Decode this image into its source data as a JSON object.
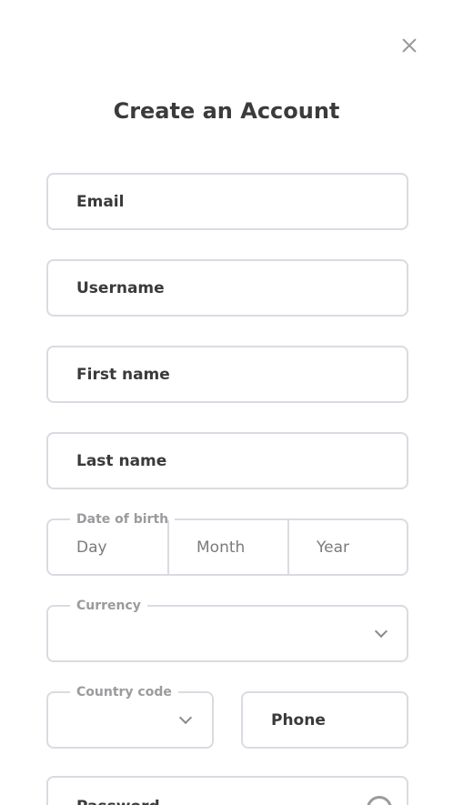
{
  "modal": {
    "title": "Create an Account"
  },
  "fields": {
    "email": {
      "placeholder": "Email"
    },
    "username": {
      "placeholder": "Username"
    },
    "first_name": {
      "placeholder": "First name"
    },
    "last_name": {
      "placeholder": "Last name"
    },
    "date_of_birth": {
      "legend": "Date of birth",
      "day": "Day",
      "month": "Month",
      "year": "Year"
    },
    "currency": {
      "legend": "Currency",
      "value": ""
    },
    "country_code": {
      "legend": "Country code",
      "value": ""
    },
    "phone": {
      "placeholder": "Phone"
    },
    "password": {
      "placeholder": "Password"
    }
  },
  "icons": {
    "close": "close-icon",
    "dropdown": "chevron-down-icon",
    "password_toggle": "eye-icon"
  }
}
